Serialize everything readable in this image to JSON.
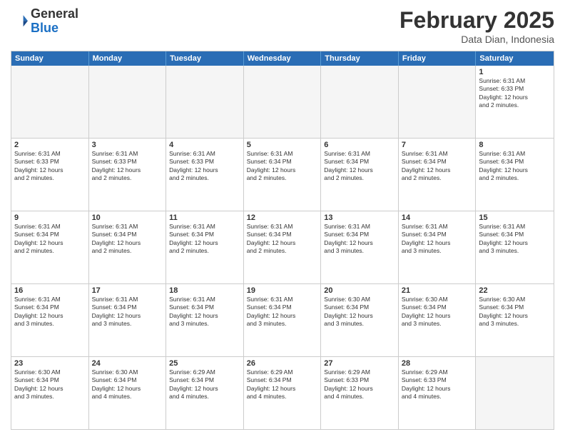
{
  "header": {
    "logo_general": "General",
    "logo_blue": "Blue",
    "month_title": "February 2025",
    "subtitle": "Data Dian, Indonesia"
  },
  "day_headers": [
    "Sunday",
    "Monday",
    "Tuesday",
    "Wednesday",
    "Thursday",
    "Friday",
    "Saturday"
  ],
  "weeks": [
    [
      {
        "day": "",
        "info": ""
      },
      {
        "day": "",
        "info": ""
      },
      {
        "day": "",
        "info": ""
      },
      {
        "day": "",
        "info": ""
      },
      {
        "day": "",
        "info": ""
      },
      {
        "day": "",
        "info": ""
      },
      {
        "day": "1",
        "info": "Sunrise: 6:31 AM\nSunset: 6:33 PM\nDaylight: 12 hours\nand 2 minutes."
      }
    ],
    [
      {
        "day": "2",
        "info": "Sunrise: 6:31 AM\nSunset: 6:33 PM\nDaylight: 12 hours\nand 2 minutes."
      },
      {
        "day": "3",
        "info": "Sunrise: 6:31 AM\nSunset: 6:33 PM\nDaylight: 12 hours\nand 2 minutes."
      },
      {
        "day": "4",
        "info": "Sunrise: 6:31 AM\nSunset: 6:33 PM\nDaylight: 12 hours\nand 2 minutes."
      },
      {
        "day": "5",
        "info": "Sunrise: 6:31 AM\nSunset: 6:34 PM\nDaylight: 12 hours\nand 2 minutes."
      },
      {
        "day": "6",
        "info": "Sunrise: 6:31 AM\nSunset: 6:34 PM\nDaylight: 12 hours\nand 2 minutes."
      },
      {
        "day": "7",
        "info": "Sunrise: 6:31 AM\nSunset: 6:34 PM\nDaylight: 12 hours\nand 2 minutes."
      },
      {
        "day": "8",
        "info": "Sunrise: 6:31 AM\nSunset: 6:34 PM\nDaylight: 12 hours\nand 2 minutes."
      }
    ],
    [
      {
        "day": "9",
        "info": "Sunrise: 6:31 AM\nSunset: 6:34 PM\nDaylight: 12 hours\nand 2 minutes."
      },
      {
        "day": "10",
        "info": "Sunrise: 6:31 AM\nSunset: 6:34 PM\nDaylight: 12 hours\nand 2 minutes."
      },
      {
        "day": "11",
        "info": "Sunrise: 6:31 AM\nSunset: 6:34 PM\nDaylight: 12 hours\nand 2 minutes."
      },
      {
        "day": "12",
        "info": "Sunrise: 6:31 AM\nSunset: 6:34 PM\nDaylight: 12 hours\nand 2 minutes."
      },
      {
        "day": "13",
        "info": "Sunrise: 6:31 AM\nSunset: 6:34 PM\nDaylight: 12 hours\nand 3 minutes."
      },
      {
        "day": "14",
        "info": "Sunrise: 6:31 AM\nSunset: 6:34 PM\nDaylight: 12 hours\nand 3 minutes."
      },
      {
        "day": "15",
        "info": "Sunrise: 6:31 AM\nSunset: 6:34 PM\nDaylight: 12 hours\nand 3 minutes."
      }
    ],
    [
      {
        "day": "16",
        "info": "Sunrise: 6:31 AM\nSunset: 6:34 PM\nDaylight: 12 hours\nand 3 minutes."
      },
      {
        "day": "17",
        "info": "Sunrise: 6:31 AM\nSunset: 6:34 PM\nDaylight: 12 hours\nand 3 minutes."
      },
      {
        "day": "18",
        "info": "Sunrise: 6:31 AM\nSunset: 6:34 PM\nDaylight: 12 hours\nand 3 minutes."
      },
      {
        "day": "19",
        "info": "Sunrise: 6:31 AM\nSunset: 6:34 PM\nDaylight: 12 hours\nand 3 minutes."
      },
      {
        "day": "20",
        "info": "Sunrise: 6:30 AM\nSunset: 6:34 PM\nDaylight: 12 hours\nand 3 minutes."
      },
      {
        "day": "21",
        "info": "Sunrise: 6:30 AM\nSunset: 6:34 PM\nDaylight: 12 hours\nand 3 minutes."
      },
      {
        "day": "22",
        "info": "Sunrise: 6:30 AM\nSunset: 6:34 PM\nDaylight: 12 hours\nand 3 minutes."
      }
    ],
    [
      {
        "day": "23",
        "info": "Sunrise: 6:30 AM\nSunset: 6:34 PM\nDaylight: 12 hours\nand 3 minutes."
      },
      {
        "day": "24",
        "info": "Sunrise: 6:30 AM\nSunset: 6:34 PM\nDaylight: 12 hours\nand 4 minutes."
      },
      {
        "day": "25",
        "info": "Sunrise: 6:29 AM\nSunset: 6:34 PM\nDaylight: 12 hours\nand 4 minutes."
      },
      {
        "day": "26",
        "info": "Sunrise: 6:29 AM\nSunset: 6:34 PM\nDaylight: 12 hours\nand 4 minutes."
      },
      {
        "day": "27",
        "info": "Sunrise: 6:29 AM\nSunset: 6:33 PM\nDaylight: 12 hours\nand 4 minutes."
      },
      {
        "day": "28",
        "info": "Sunrise: 6:29 AM\nSunset: 6:33 PM\nDaylight: 12 hours\nand 4 minutes."
      },
      {
        "day": "",
        "info": ""
      }
    ]
  ]
}
